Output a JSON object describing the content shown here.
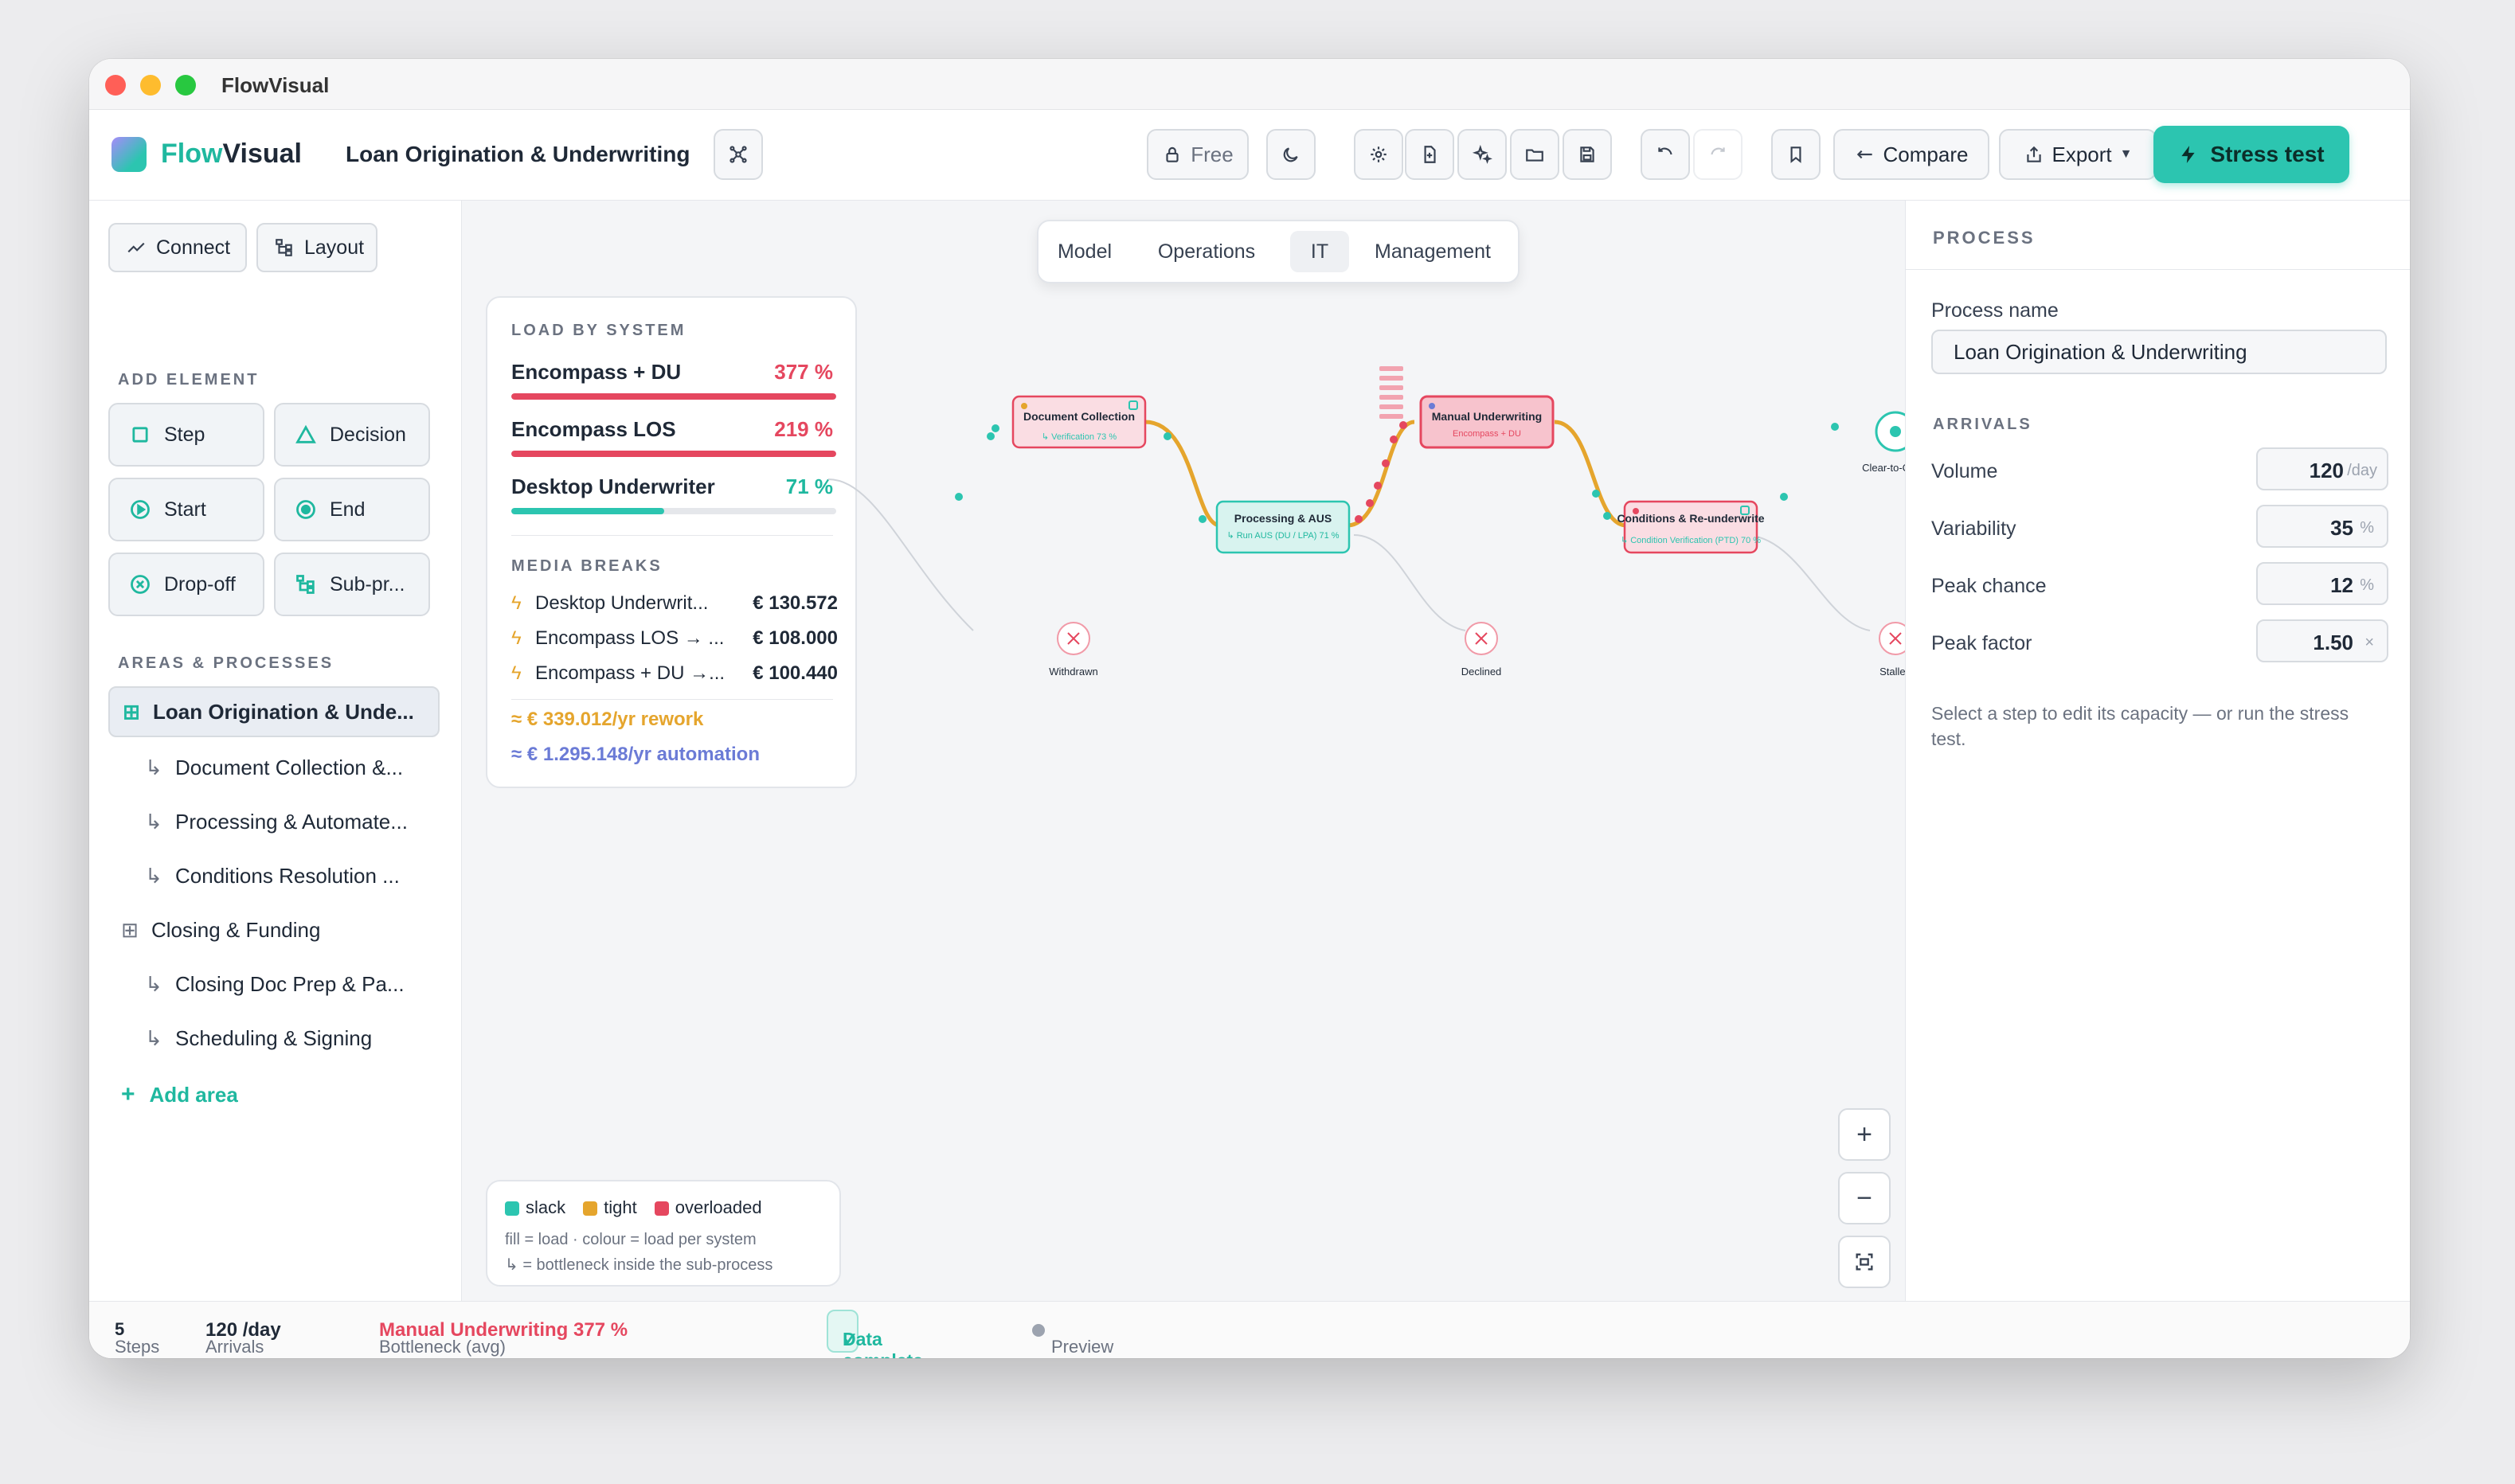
{
  "window": {
    "title": "FlowVisual"
  },
  "appbar": {
    "brand_first": "Flow",
    "brand_second": "Visual",
    "process_title": "Loan Origination & Underwriting",
    "free_label": "Free",
    "compare_label": "Compare",
    "export_label": "Export",
    "stress_label": "Stress test"
  },
  "left": {
    "connect_label": "Connect",
    "layout_label": "Layout",
    "add_element_heading": "ADD ELEMENT",
    "elements": [
      "Step",
      "Decision",
      "Start",
      "End",
      "Drop-off",
      "Sub-pr..."
    ],
    "areas_heading": "AREAS & PROCESSES",
    "tree": [
      {
        "label": "Loan Origination & Unde...",
        "level": 0,
        "selected": true
      },
      {
        "label": "Document Collection &...",
        "level": 1
      },
      {
        "label": "Processing & Automate...",
        "level": 1
      },
      {
        "label": "Conditions Resolution ...",
        "level": 1
      },
      {
        "label": "Closing & Funding",
        "level": 0
      },
      {
        "label": "Closing Doc Prep & Pa...",
        "level": 1
      },
      {
        "label": "Scheduling & Signing",
        "level": 1
      }
    ],
    "add_area_label": "Add area"
  },
  "tabs": [
    "Model",
    "Operations",
    "IT",
    "Management"
  ],
  "active_tab": "IT",
  "load_card": {
    "heading": "LOAD BY SYSTEM",
    "systems": [
      {
        "name": "Encompass + DU",
        "pct": "377 %",
        "fill": 1.0,
        "color": "#e5475f"
      },
      {
        "name": "Encompass LOS",
        "pct": "219 %",
        "fill": 1.0,
        "color": "#e5475f"
      },
      {
        "name": "Desktop Underwriter",
        "pct": "71 %",
        "fill": 0.71,
        "color": "#2cc5b0"
      }
    ],
    "media_heading": "MEDIA BREAKS",
    "media": [
      {
        "name": "Desktop Underwrit...",
        "value": "€ 130.572"
      },
      {
        "name": "Encompass LOS → ...",
        "value": "€ 108.000"
      },
      {
        "name": "Encompass + DU →...",
        "value": "€ 100.440"
      }
    ],
    "rework": "≈ € 339.012/yr rework",
    "automation": "≈ € 1.295.148/yr automation"
  },
  "legend": {
    "slack": "slack",
    "tight": "tight",
    "overloaded": "overloaded",
    "note1": "fill = load · colour = load per system",
    "note2": "↳ = bottleneck inside the sub-process"
  },
  "diagram": {
    "nodes": {
      "doc_title": "Document Collection",
      "doc_sub": "↳ Verification 73 %",
      "proc_title": "Processing & AUS",
      "proc_sub": "↳ Run AUS (DU / LPA) 71 %",
      "mu_title": "Manual Underwriting",
      "mu_sub": "Encompass + DU",
      "cond_title": "Conditions & Re-underwrite",
      "cond_sub": "↳ Condition Verification (PTD) 70 %",
      "end_label": "Clear-to-Close",
      "drop1": "Withdrawn",
      "drop2": "Declined",
      "drop3": "Stalled"
    }
  },
  "right": {
    "heading": "PROCESS",
    "name_label": "Process name",
    "name_value": "Loan Origination & Underwriting",
    "arrivals_heading": "ARRIVALS",
    "fields": [
      {
        "label": "Volume",
        "value": "120",
        "unit": "/day"
      },
      {
        "label": "Variability",
        "value": "35",
        "unit": "%"
      },
      {
        "label": "Peak chance",
        "value": "12",
        "unit": "%"
      },
      {
        "label": "Peak factor",
        "value": "1.50",
        "unit": "×"
      }
    ],
    "hint": "Select a step to edit its capacity — or run the stress test."
  },
  "status": {
    "steps_label": "Steps",
    "steps_value": "5",
    "arrivals_label": "Arrivals",
    "arrivals_value": "120 /day",
    "bottleneck_label": "Bottleneck (avg)",
    "bottleneck_value": "Manual Underwriting 377 %",
    "data_complete": "Data complete",
    "preview": "Preview · run the stress test for reliable numbers"
  },
  "colors": {
    "accent": "#2cc5b0",
    "overloaded": "#e5475f",
    "tight": "#e5a52d",
    "link": "#6b7bd6"
  }
}
